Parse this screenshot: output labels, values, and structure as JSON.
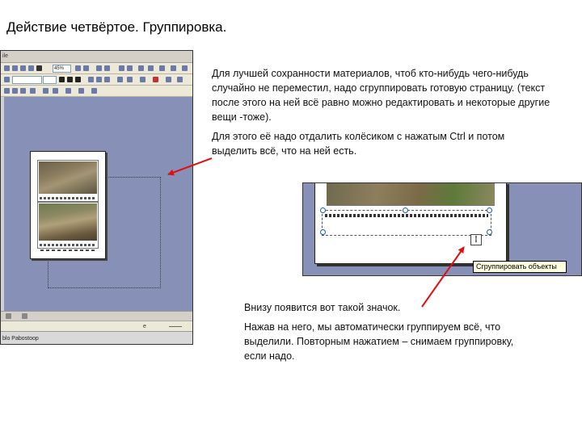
{
  "title": "Действие четвёртое. Группировка.",
  "top_text": {
    "paragraph1": "Для лучшей сохранности материалов, чтоб кто-нибудь чего-нибудь случайно не переместил, надо сгруппировать готовую страницу. (текст после этого на ней всё равно можно редактировать и некоторые другие вещи -тоже).",
    "paragraph2": "Для этого её надо отдалить колёсиком с нажатым Ctrl и потом выделить всё, что на ней есть."
  },
  "bottom_text": {
    "paragraph1": "Внизу появится вот такой значок.",
    "paragraph2": "Нажав на него, мы автоматически группируем всё, что выделили. Повторным нажатием – снимаем группировку, если надо."
  },
  "screenshot1": {
    "menu_fragment": "ile",
    "zoom_value": "45%",
    "status_fragment": "e",
    "taskbar_fragment": "blo Pabostoop"
  },
  "screenshot2": {
    "group_icon_glyph": "⁞",
    "tooltip": "Сгруппировать объекты"
  },
  "colors": {
    "workspace": "#8791b8",
    "arrow": "#e01010",
    "tooltip_bg": "#ffffe1"
  }
}
